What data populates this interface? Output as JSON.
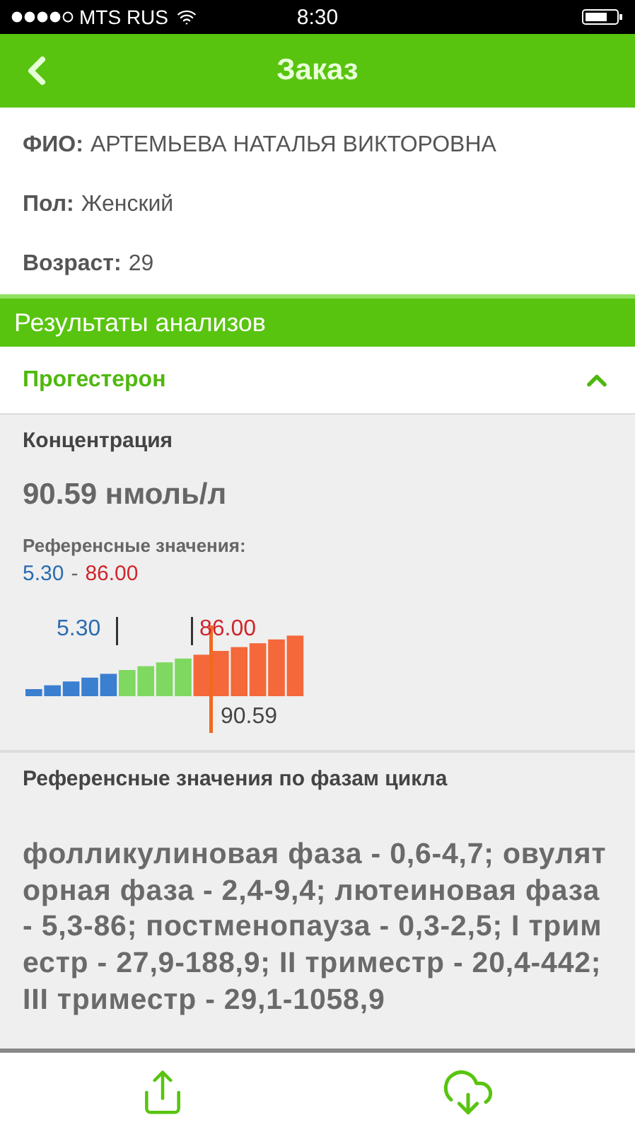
{
  "status_bar": {
    "carrier": "MTS RUS",
    "time": "8:30"
  },
  "header": {
    "title": "Заказ"
  },
  "patient": [
    {
      "label": "ФИО:",
      "value": "АРТЕМЬЕВА НАТАЛЬЯ ВИКТОРОВНА"
    },
    {
      "label": "Пол:",
      "value": "Женский"
    },
    {
      "label": "Возраст:",
      "value": "29"
    }
  ],
  "section_title": "Результаты анализов",
  "analysis": {
    "name": "Прогестерон",
    "expanded": true,
    "concentration_label": "Концентрация",
    "concentration": "90.59 нмоль/л",
    "reference_label": "Референсные значения:",
    "reference_low": "5.30",
    "reference_separator": "-",
    "reference_high": "86.00",
    "scale": {
      "low": "5.30",
      "high": "86.00",
      "value": "90.59"
    },
    "phases_title": "Референсные значения по фазам цикла",
    "phases_text": "фолликулиновая фаза - 0,6-4,7; овуляторная фаза - 2,4-9,4; лютеиновая фаза - 5,3-86; постменопауза - 0,3-2,5; I триместр - 27,9-188,9; II триместр - 20,4-442; III триместр - 29,1-1058,9"
  }
}
